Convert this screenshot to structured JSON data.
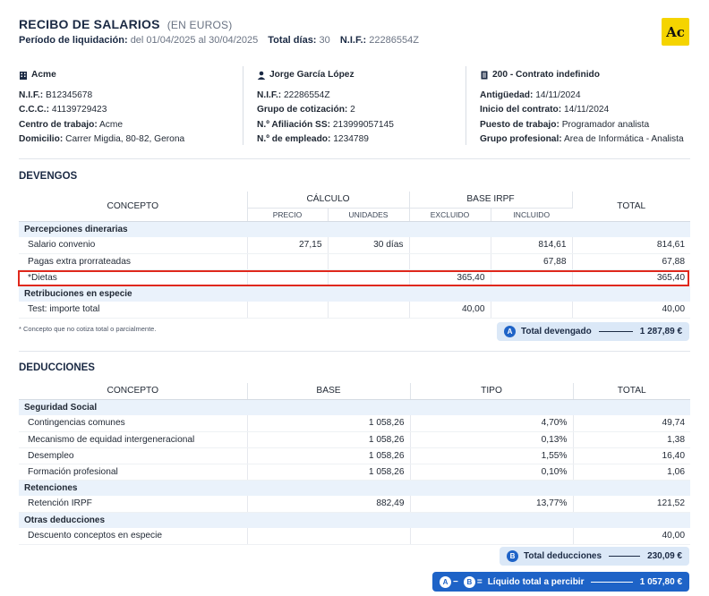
{
  "header": {
    "title": "RECIBO DE SALARIOS",
    "title_unit": "(EN EUROS)",
    "period_label": "Período de liquidación:",
    "period_value": "del 01/04/2025 al 30/04/2025",
    "days_label": "Total días:",
    "days_value": "30",
    "nif_label": "N.I.F.:",
    "nif_value": "22286554Z",
    "logo_text": "Ac"
  },
  "company": {
    "name": "Acme",
    "icon": "building-icon",
    "nif_label": "N.I.F.:",
    "nif": "B12345678",
    "ccc_label": "C.C.C.:",
    "ccc": "41139729423",
    "center_label": "Centro de trabajo:",
    "center": "Acme",
    "address_label": "Domicilio:",
    "address": "Carrer Migdia, 80-82, Gerona"
  },
  "employee": {
    "name": "Jorge García López",
    "icon": "person-icon",
    "nif_label": "N.I.F.:",
    "nif": "22286554Z",
    "group_label": "Grupo de cotización:",
    "group": "2",
    "ss_label": "N.º Afiliación SS:",
    "ss": "213999057145",
    "num_label": "N.º de empleado:",
    "num": "1234789"
  },
  "contract": {
    "title": "200 - Contrato indefinido",
    "icon": "document-icon",
    "seniority_label": "Antigüedad:",
    "seniority": "14/11/2024",
    "start_label": "Inicio del contrato:",
    "start": "14/11/2024",
    "position_label": "Puesto de trabajo:",
    "position": "Programador analista",
    "prof_group_label": "Grupo profesional:",
    "prof_group": "Area de Informática - Analista"
  },
  "devengos": {
    "title": "DEVENGOS",
    "col_concept": "CONCEPTO",
    "col_calc": "CÁLCULO",
    "col_price": "PRECIO",
    "col_units": "UNIDADES",
    "col_base": "BASE IRPF",
    "col_excl": "EXCLUIDO",
    "col_incl": "INCLUIDO",
    "col_total": "TOTAL",
    "cat1": "Percepciones dinerarias",
    "rows1": [
      {
        "concept": "Salario convenio",
        "price": "27,15",
        "units": "30 días",
        "excl": "",
        "incl": "814,61",
        "total": "814,61"
      },
      {
        "concept": "Pagas extra prorrateadas",
        "price": "",
        "units": "",
        "excl": "",
        "incl": "67,88",
        "total": "67,88"
      },
      {
        "concept": "*Dietas",
        "price": "",
        "units": "",
        "excl": "365,40",
        "incl": "",
        "total": "365,40"
      }
    ],
    "cat2": "Retribuciones en especie",
    "rows2": [
      {
        "concept": "Test: importe total",
        "price": "",
        "units": "",
        "excl": "40,00",
        "incl": "",
        "total": "40,00"
      }
    ],
    "note": "* Concepto que no cotiza total o parcialmente.",
    "total_badge": "A",
    "total_label": "Total devengado",
    "total_value": "1 287,89 €"
  },
  "deducciones": {
    "title": "DEDUCCIONES",
    "col_concept": "CONCEPTO",
    "col_base": "BASE",
    "col_type": "TIPO",
    "col_total": "TOTAL",
    "cat1": "Seguridad Social",
    "rows1": [
      {
        "concept": "Contingencias comunes",
        "base": "1 058,26",
        "type": "4,70%",
        "total": "49,74"
      },
      {
        "concept": "Mecanismo de equidad intergeneracional",
        "base": "1 058,26",
        "type": "0,13%",
        "total": "1,38"
      },
      {
        "concept": "Desempleo",
        "base": "1 058,26",
        "type": "1,55%",
        "total": "16,40"
      },
      {
        "concept": "Formación profesional",
        "base": "1 058,26",
        "type": "0,10%",
        "total": "1,06"
      }
    ],
    "cat2": "Retenciones",
    "rows2": [
      {
        "concept": "Retención IRPF",
        "base": "882,49",
        "type": "13,77%",
        "total": "121,52"
      }
    ],
    "cat3": "Otras deducciones",
    "rows3": [
      {
        "concept": "Descuento conceptos en especie",
        "base": "",
        "type": "",
        "total": "40,00"
      }
    ],
    "total_badge": "B",
    "total_label": "Total deducciones",
    "total_value": "230,09 €"
  },
  "net": {
    "badge_a": "A",
    "minus": "−",
    "badge_b": "B",
    "equals": "=",
    "label": "Líquido total a percibir",
    "value": "1 057,80 €"
  },
  "colors": {
    "accent": "#1e63c7",
    "category_bg": "#eaf2fb",
    "highlight": "#e0281c",
    "logo_bg": "#f5d400"
  }
}
